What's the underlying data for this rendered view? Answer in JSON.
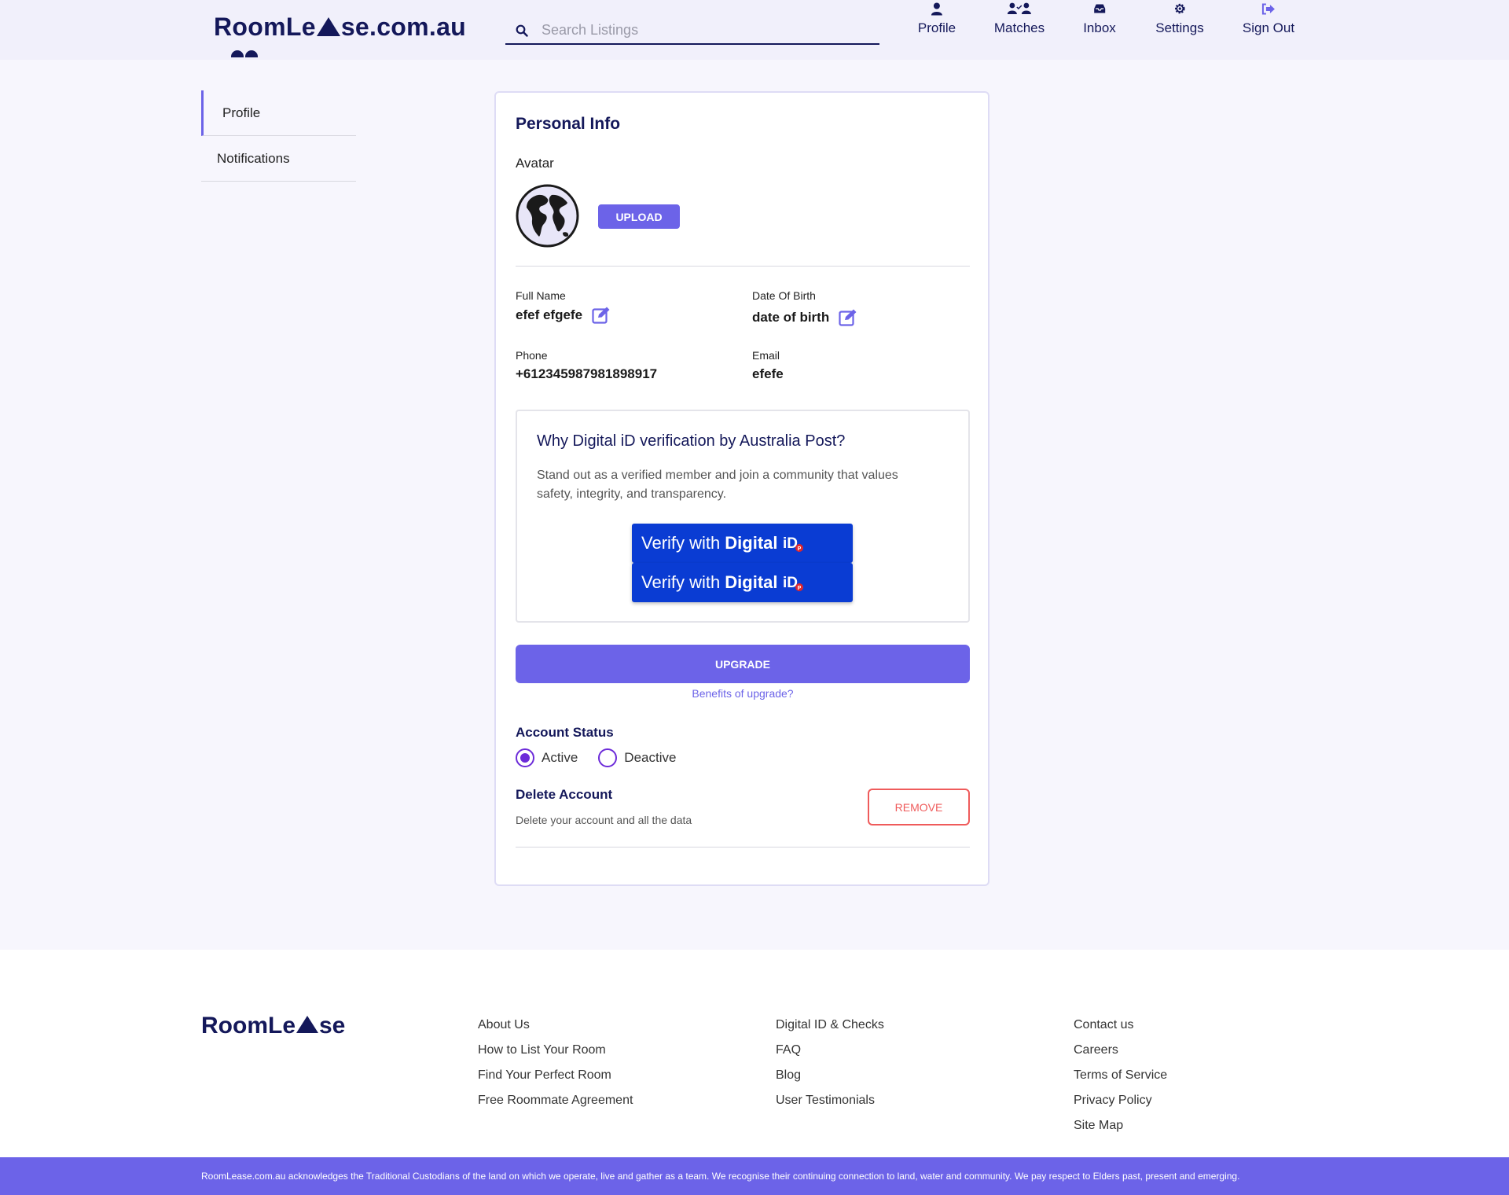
{
  "header": {
    "logo_part1": "RoomLe",
    "logo_part2": "se.com.au",
    "search_placeholder": "Search Listings",
    "nav": [
      {
        "label": "Profile",
        "icon": "user-icon"
      },
      {
        "label": "Matches",
        "icon": "users-icon"
      },
      {
        "label": "Inbox",
        "icon": "inbox-icon"
      },
      {
        "label": "Settings",
        "icon": "gear-icon"
      },
      {
        "label": "Sign Out",
        "icon": "sign-out-icon"
      }
    ]
  },
  "sidebar": {
    "items": [
      {
        "label": "Profile",
        "active": true
      },
      {
        "label": "Notifications",
        "active": false
      }
    ]
  },
  "card": {
    "title": "Personal Info",
    "avatar_label": "Avatar",
    "avatar_icon": "globe-icon",
    "upload_label": "UPLOAD",
    "fields": {
      "full_name_label": "Full Name",
      "full_name_value": "efef efgefe",
      "dob_label": "Date Of Birth",
      "dob_value": "date of birth",
      "phone_label": "Phone",
      "phone_value": "+612345987981898917",
      "email_label": "Email",
      "email_value": "efefe"
    },
    "verify": {
      "title": "Why Digital iD verification by Australia Post?",
      "description": "Stand out as a verified member and join a community that values safety, integrity, and transparency.",
      "button_prefix": "Verify with",
      "button_bold": "Digital",
      "button_logo": "iD"
    },
    "upgrade_label": "UPGRADE",
    "benefits_link": "Benefits of upgrade?",
    "account_status": {
      "title": "Account Status",
      "options": [
        "Active",
        "Deactive"
      ],
      "selected": "Active"
    },
    "delete": {
      "title": "Delete Account",
      "description": "Delete your account and all the data",
      "button": "REMOVE"
    }
  },
  "footer": {
    "logo_part1": "RoomLe",
    "logo_part2": "se",
    "col1": [
      "About Us",
      "How to List Your Room",
      "Find Your Perfect Room",
      "Free Roommate Agreement"
    ],
    "col2": [
      "Digital ID & Checks",
      "FAQ",
      "Blog",
      "User Testimonials"
    ],
    "col3": [
      "Contact us",
      "Careers",
      "Terms of Service",
      "Privacy Policy",
      "Site Map"
    ],
    "acknowledgement": "RoomLease.com.au acknowledges the Traditional Custodians of the land on which we operate, live and gather as a team. We recognise their continuing connection to land, water and community. We pay respect to Elders past, present and emerging."
  },
  "colors": {
    "brand_navy": "#14185a",
    "accent_purple": "#6c63e8",
    "digital_id_blue": "#0a3cd3",
    "danger_red": "#ef5b5b"
  }
}
